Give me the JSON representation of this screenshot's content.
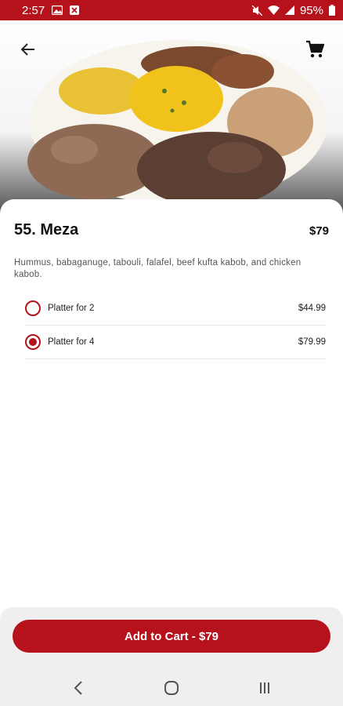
{
  "status_bar": {
    "time": "2:57",
    "battery_percent": "95%",
    "icons": [
      "gallery-icon",
      "notification-icon",
      "mute-icon",
      "wifi-icon",
      "signal-icon",
      "battery-icon"
    ]
  },
  "header": {
    "back_icon": "arrow-left-icon",
    "cart_icon": "shopping-cart-icon"
  },
  "item": {
    "title": "55. Meza",
    "price": "$79",
    "description": "Hummus, babaganuge, tabouli, falafel, beef kufta kabob, and chicken kabob."
  },
  "options": [
    {
      "label": "Platter for 2",
      "price": "$44.99",
      "selected": false
    },
    {
      "label": "Platter for 4",
      "price": "$79.99",
      "selected": true
    }
  ],
  "footer": {
    "add_to_cart_label": "Add to Cart - $79"
  },
  "nav": {
    "icons": [
      "back-nav-icon",
      "home-nav-icon",
      "recents-nav-icon"
    ]
  },
  "colors": {
    "accent": "#b5121b",
    "footer_bg": "#efefef",
    "text": "#111111"
  }
}
